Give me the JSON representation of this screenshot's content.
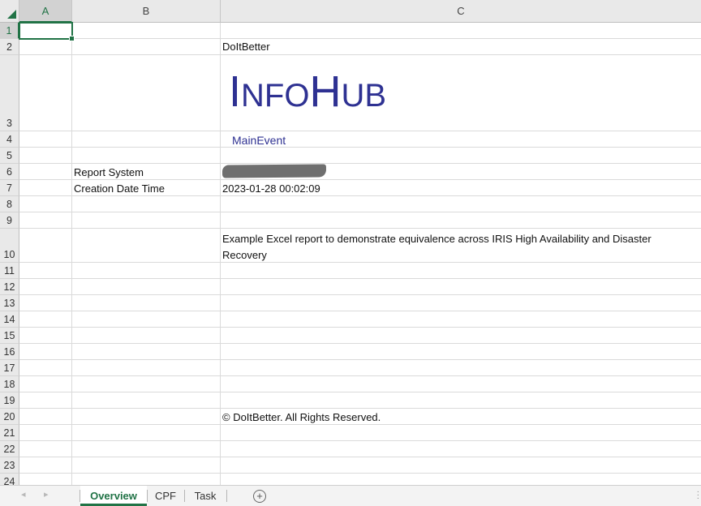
{
  "columns": {
    "a": "A",
    "b": "B",
    "c": "C"
  },
  "rows": [
    "1",
    "2",
    "3",
    "4",
    "5",
    "6",
    "7",
    "8",
    "9",
    "10",
    "11",
    "12",
    "13",
    "14",
    "15",
    "16",
    "17",
    "18",
    "19",
    "20",
    "21",
    "22",
    "23",
    "24"
  ],
  "cells": {
    "c2": "DoItBetter",
    "logo_first_big": "I",
    "logo_first_small": "NFO",
    "logo_second_big": "H",
    "logo_second_small": "UB",
    "c4": "MainEvent",
    "b6": "Report System",
    "b7": "Creation Date Time",
    "c7": "2023-01-28 00:02:09",
    "c10": "Example Excel report to demonstrate equivalence across IRIS High Availability and Disaster Recovery",
    "c20": "© DoItBetter. All Rights Reserved."
  },
  "tabs": [
    "Overview",
    "CPF",
    "Task"
  ],
  "active_tab": "Overview",
  "colors": {
    "accent": "#217346",
    "logo": "#2e3192"
  }
}
